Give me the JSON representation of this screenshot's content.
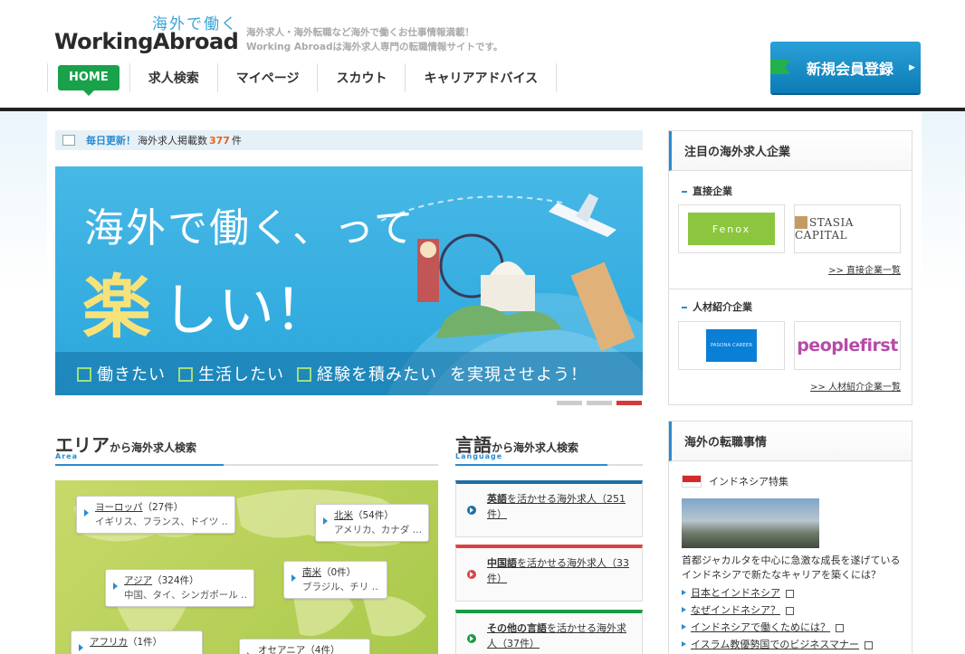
{
  "header": {
    "logo_jp": "海外で働く",
    "logo_en": "WorkingAbroad",
    "tagline_line1": "海外求人・海外転職など海外で働くお仕事情報満載！",
    "tagline_line2": "Working Abroadは海外求人専門の転職情報サイトです。",
    "nav": [
      "HOME",
      "求人検索",
      "マイページ",
      "スカウト",
      "キャリアアドバイス"
    ],
    "register_label": "新規会員登録"
  },
  "update_bar": {
    "daily": "毎日更新！",
    "label": "海外求人掲載数",
    "count": "377",
    "unit": "件"
  },
  "hero": {
    "line1": "海外で働く、って",
    "line2a": "楽",
    "line2b": "しい！",
    "checks": [
      "働きたい",
      "生活したい",
      "経験を積みたい"
    ],
    "suffix": "を実現させよう！",
    "slides": 3,
    "active_slide": 3
  },
  "area": {
    "title_big": "エリア",
    "title_rest": "から海外求人検索",
    "title_en": "Area",
    "regions": [
      {
        "name": "ヨーロッパ",
        "count": "（27件）",
        "sub": "イギリス、フランス、ドイツ …"
      },
      {
        "name": "北米",
        "count": "（54件）",
        "sub": "アメリカ、カナダ …"
      },
      {
        "name": "アジア",
        "count": "（324件）",
        "sub": "中国、タイ、シンガポール …"
      },
      {
        "name": "南米",
        "count": "（0件）",
        "sub": "ブラジル、チリ …"
      },
      {
        "name": "アフリカ",
        "count": "（1件）",
        "sub": ""
      },
      {
        "name": "オセアニア",
        "count": "（4件）",
        "sub": ""
      }
    ]
  },
  "language": {
    "title_big": "言語",
    "title_rest": "から海外求人検索",
    "title_en": "Language",
    "items": [
      {
        "lang": "英語",
        "rest": "を活かせる海外求人（251件）",
        "color": "#1d6fa8"
      },
      {
        "lang": "中国語",
        "rest": "を活かせる海外求人（33件）",
        "color": "#d94343"
      },
      {
        "lang": "その他の言語",
        "rest": "を活かせる海外求人（37件）",
        "color": "#1c9b43"
      }
    ]
  },
  "sidebar": {
    "companies_title": "注目の海外求人企業",
    "direct_title": "直接企業",
    "direct_logos": [
      "Fenox",
      "STASIA CAPITAL"
    ],
    "direct_more": ">> 直接企業一覧",
    "agency_title": "人材紹介企業",
    "agency_logos": [
      "PASONA CAREER",
      "peoplefirst"
    ],
    "agency_more": ">> 人材紹介企業一覧",
    "news_title": "海外の転職事情",
    "feature_title": "インドネシア特集",
    "feature_desc": "首都ジャカルタを中心に急激な成長を遂げているインドネシアで新たなキャリアを築くには？",
    "links": [
      "日本とインドネシア",
      "なぜインドネシア？",
      "インドネシアで働くためには？",
      "イスラム教優勢国でのビジネスマナー"
    ]
  }
}
